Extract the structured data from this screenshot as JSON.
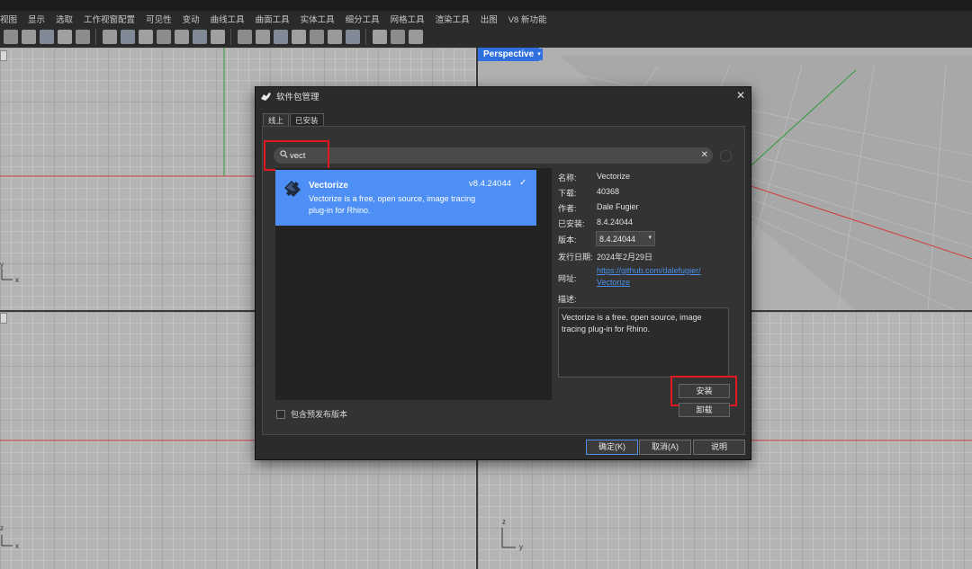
{
  "menubar": [
    "视图",
    "显示",
    "选取",
    "工作视窗配置",
    "可见性",
    "变动",
    "曲线工具",
    "曲面工具",
    "实体工具",
    "细分工具",
    "网格工具",
    "渲染工具",
    "出图",
    "V8 新功能"
  ],
  "toolbar_icons": [
    "shape-icon",
    "shape-icon",
    "shape-icon",
    "shape-icon",
    "shape-icon",
    "shape-icon",
    "shape-icon",
    "shape-icon",
    "shape-icon",
    "shape-icon",
    "shape-icon",
    "shape-icon",
    "shape-icon",
    "shape-icon",
    "shape-icon",
    "shape-icon",
    "shape-icon",
    "shape-icon",
    "shape-icon",
    "shape-icon",
    "shape-icon",
    "shape-icon"
  ],
  "viewport": {
    "perspective_label": "Perspective",
    "axis_x": "x",
    "axis_y": "y",
    "axis_z": "z"
  },
  "dialog": {
    "title": "软件包管理",
    "close": "✕",
    "tabs": [
      "线上",
      "已安装"
    ],
    "search": {
      "value": "vect",
      "placeholder": ""
    },
    "result": {
      "name": "Vectorize",
      "version": "v8.4.24044",
      "description": "Vectorize is a free, open source, image tracing plug-in for Rhino."
    },
    "prerelease_label": "包含预发布版本",
    "details": {
      "name_label": "名称:",
      "name_value": "Vectorize",
      "downloads_label": "下载:",
      "downloads_value": "40368",
      "author_label": "作者:",
      "author_value": "Dale Fugier",
      "installed_label": "已安装:",
      "installed_value": "8.4.24044",
      "version_label": "版本:",
      "version_value": "8.4.24044",
      "release_label": "发行日期:",
      "release_value": "2024年2月29日",
      "url_label": "网址:",
      "url_line1": "https://github.com/dalefugier/",
      "url_line2": "Vectorize",
      "desc_label": "描述:",
      "desc_value": "Vectorize is a free, open source, image tracing plug-in for Rhino."
    },
    "install_button": "安装",
    "uninstall_button": "卸载",
    "ok_button": "确定(K)",
    "cancel_button": "取消(A)",
    "help_button": "说明"
  },
  "colors": {
    "highlight": "#e0191e",
    "selection": "#4d8ff5",
    "perspective_tab": "#2f6fe0",
    "x_axis": "#d23a3a",
    "y_axis": "#2f9b3a"
  }
}
